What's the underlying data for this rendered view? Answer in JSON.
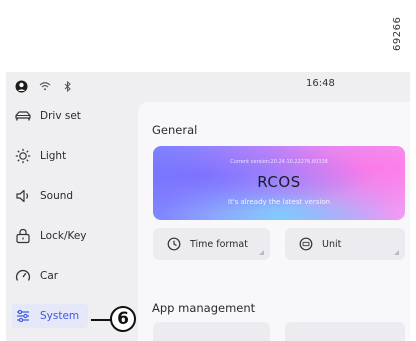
{
  "reference_code": "69266",
  "status_bar": {
    "time": "16:48"
  },
  "sidebar": {
    "items": [
      {
        "label": "Driv set",
        "icon": "car-body-icon"
      },
      {
        "label": "Light",
        "icon": "light-icon"
      },
      {
        "label": "Sound",
        "icon": "speaker-icon"
      },
      {
        "label": "Lock/Key",
        "icon": "lock-icon"
      },
      {
        "label": "Car",
        "icon": "gauge-icon"
      },
      {
        "label": "System",
        "icon": "sliders-icon",
        "active": true
      }
    ]
  },
  "callout": {
    "number": "6"
  },
  "main": {
    "general_title": "General",
    "version_card": {
      "version_line": "Current version:20.24.10.22276.60338",
      "product_name": "RCOS",
      "status": "It's already the latest version"
    },
    "tiles": [
      {
        "label": "Time format",
        "icon": "clock-icon"
      },
      {
        "label": "Unit",
        "icon": "unit-icon"
      }
    ],
    "app_management_title": "App management"
  },
  "colors": {
    "accent": "#3e57e3",
    "screen_bg": "#efeff2",
    "panel_bg": "#f8f8fa",
    "tile_bg": "#ecebef"
  }
}
